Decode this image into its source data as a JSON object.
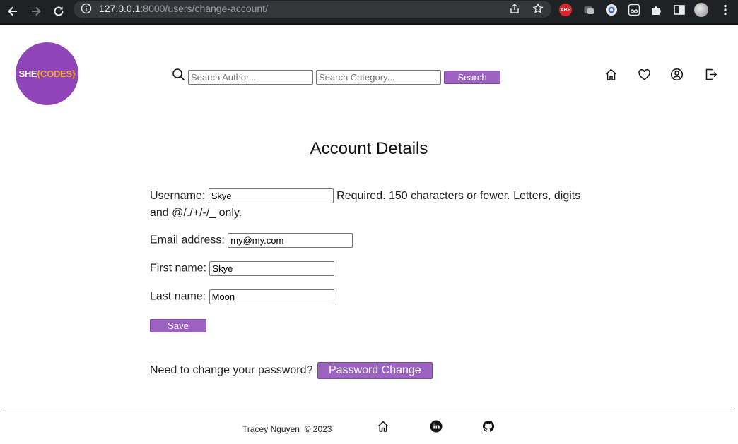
{
  "browser": {
    "url_host": "127.0.0.1",
    "url_rest": ":8000/users/change-account/",
    "extension_abp": "ABP"
  },
  "header": {
    "logo_she": "SHE",
    "logo_codes": "{CODES}",
    "search_author_placeholder": "Search Author...",
    "search_category_placeholder": "Search Category...",
    "search_button": "Search"
  },
  "main": {
    "title": "Account Details",
    "form": {
      "username_label": "Username:",
      "username_value": "Skye",
      "username_help": "Required. 150 characters or fewer. Letters, digits and @/./+/-/_ only.",
      "email_label": "Email address:",
      "email_value": "my@my.com",
      "first_name_label": "First name:",
      "first_name_value": "Skye",
      "last_name_label": "Last name:",
      "last_name_value": "Moon",
      "save_button": "Save"
    },
    "password_prompt": "Need to change your password?",
    "password_button": "Password Change"
  },
  "footer": {
    "author": "Tracey Nguyen",
    "copyright": "© 2023"
  },
  "colors": {
    "accent": "#9b62c2",
    "logo_bg": "#8f45b8",
    "logo_codes": "#f2a73b",
    "chrome_bg": "#202124"
  }
}
